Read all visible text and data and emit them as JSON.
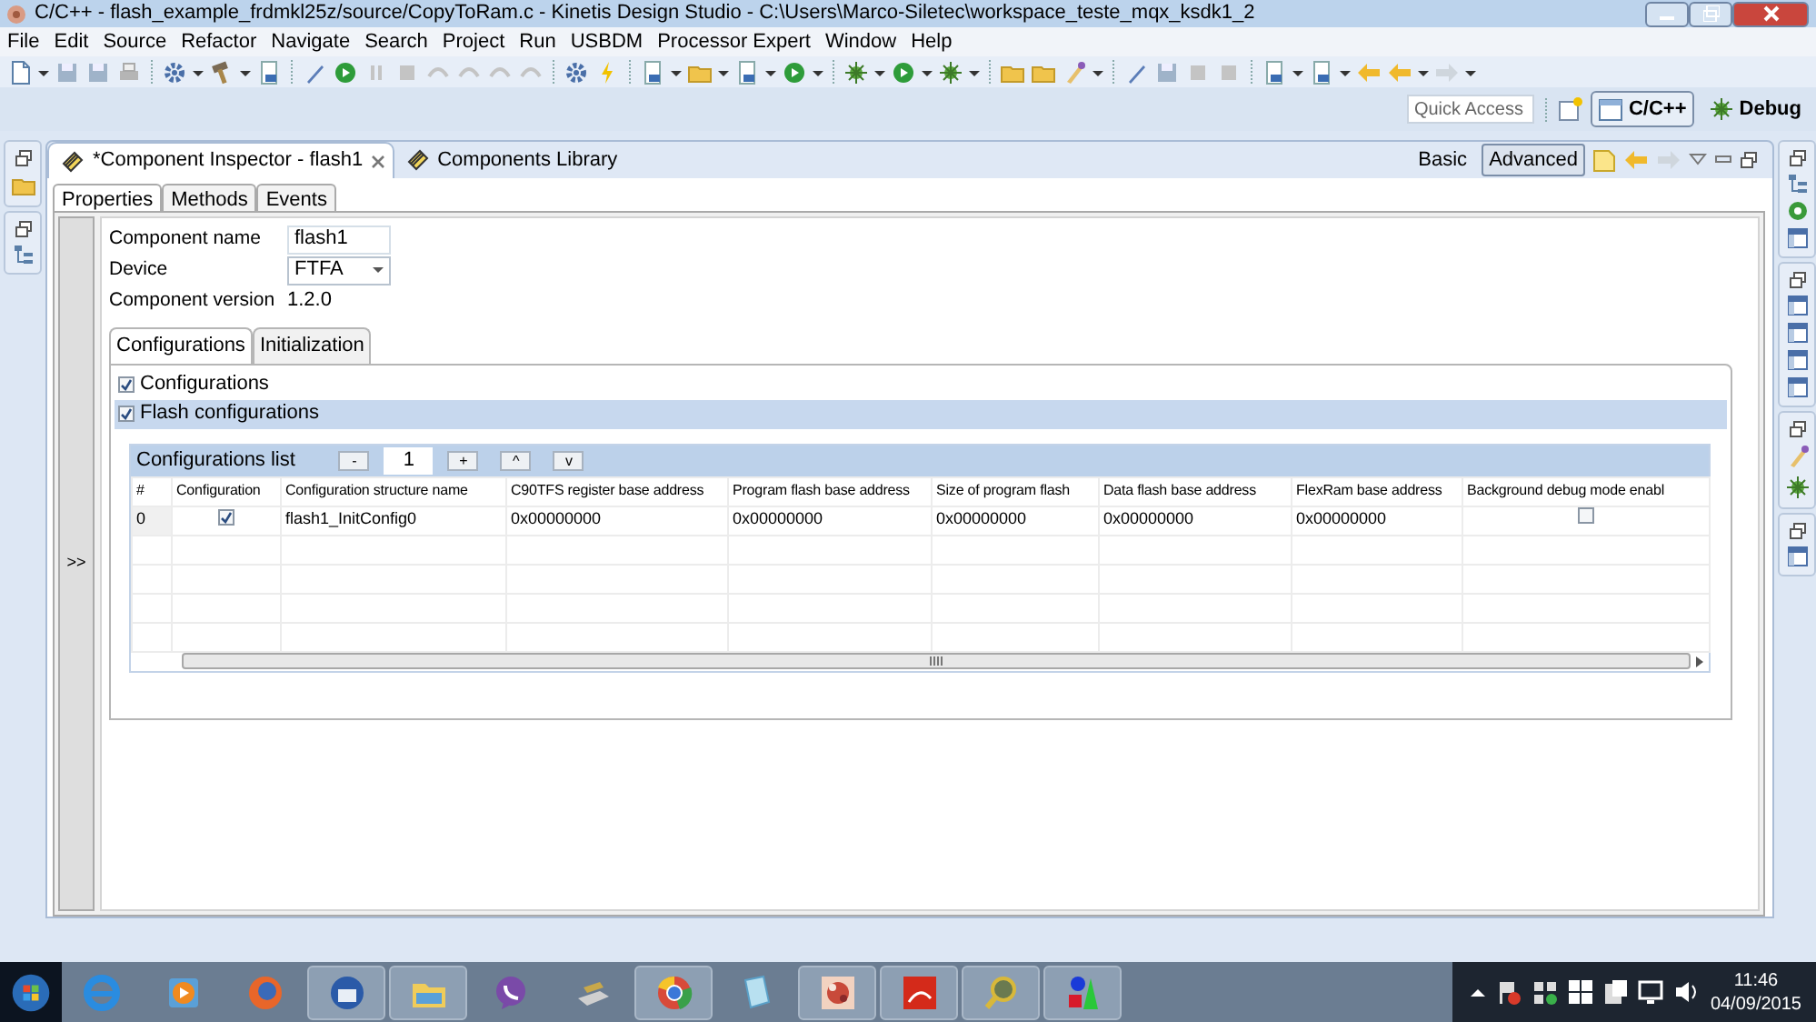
{
  "window": {
    "title": "C/C++ - flash_example_frdmkl25z/source/CopyToRam.c - Kinetis Design Studio - C:\\Users\\Marco-Siletec\\workspace_teste_mqx_ksdk1_2"
  },
  "menu": [
    "File",
    "Edit",
    "Source",
    "Refactor",
    "Navigate",
    "Search",
    "Project",
    "Run",
    "USBDM",
    "Processor Expert",
    "Window",
    "Help"
  ],
  "quick_access": {
    "placeholder": "Quick Access"
  },
  "perspectives": [
    {
      "label": "C/C++",
      "selected": true
    },
    {
      "label": "Debug",
      "selected": false
    }
  ],
  "editor_tabs": [
    {
      "label": "*Component Inspector - flash1",
      "selected": true
    },
    {
      "label": "Components Library",
      "selected": false
    }
  ],
  "modes": [
    {
      "label": "Basic",
      "selected": false
    },
    {
      "label": "Advanced",
      "selected": true
    }
  ],
  "inspector_tabs": [
    {
      "label": "Properties",
      "selected": true
    },
    {
      "label": "Methods",
      "selected": false
    },
    {
      "label": "Events",
      "selected": false
    }
  ],
  "expand_button": ">>",
  "properties": [
    {
      "kind": "text",
      "label": "Component name",
      "value": "flash1"
    },
    {
      "kind": "select",
      "label": "Device",
      "value": "FTFA"
    },
    {
      "kind": "static",
      "label": "Component version",
      "value": "1.2.0"
    }
  ],
  "group_tabs": [
    {
      "label": "Configurations",
      "selected": true
    },
    {
      "label": "Initialization",
      "selected": false
    }
  ],
  "sections": [
    {
      "label": "Configurations",
      "checked": true,
      "highlighted": false
    },
    {
      "label": "Flash configurations",
      "checked": true,
      "highlighted": true
    }
  ],
  "config_list": {
    "label": "Configurations list",
    "count": "1",
    "buttons": [
      "-",
      "+",
      "^",
      "v"
    ],
    "columns": [
      "#",
      "Configuration",
      "Configuration structure name",
      "C90TFS register base address",
      "Program flash base address",
      "Size of program flash",
      "Data flash base address",
      "FlexRam base address",
      "Background debug mode enabl"
    ],
    "rows": [
      {
        "cells": [
          {
            "kind": "text",
            "text": "0"
          },
          {
            "kind": "check",
            "checked": true
          },
          {
            "kind": "text",
            "text": "flash1_InitConfig0"
          },
          {
            "kind": "text",
            "text": "0x00000000"
          },
          {
            "kind": "text",
            "text": "0x00000000"
          },
          {
            "kind": "text",
            "text": "0x00000000"
          },
          {
            "kind": "text",
            "text": "0x00000000"
          },
          {
            "kind": "text",
            "text": "0x00000000"
          },
          {
            "kind": "check",
            "checked": false
          }
        ]
      }
    ]
  },
  "taskbar": {
    "apps": [
      {
        "running": false
      },
      {
        "running": false
      },
      {
        "running": false
      },
      {
        "running": true
      },
      {
        "running": true
      },
      {
        "running": false
      },
      {
        "running": false
      },
      {
        "running": true
      },
      {
        "running": false
      },
      {
        "running": true
      },
      {
        "running": true
      },
      {
        "running": true
      },
      {
        "running": true
      }
    ],
    "time": "11:46",
    "date": "04/09/2015"
  }
}
